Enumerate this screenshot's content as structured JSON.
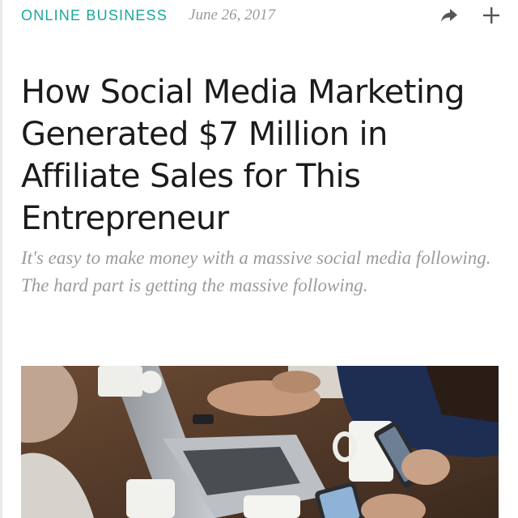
{
  "article": {
    "category": "ONLINE BUSINESS",
    "date": "June 26, 2017",
    "title": "How Social Media Marketing Generated $7 Million in Affiliate Sales for This Entrepreneur",
    "subtitle": "It's easy to make money with a massive social media following. The hard part is getting the massive following."
  },
  "actions": {
    "share_icon": "share-arrow-icon",
    "add_icon": "plus-icon"
  },
  "hero_image": {
    "subject": "people-at-table-with-laptop-and-phones"
  },
  "colors": {
    "category": "#1aa69c",
    "title": "#1b1b1b",
    "subtitle": "#9b9b9b",
    "date": "#9a9a9a"
  }
}
